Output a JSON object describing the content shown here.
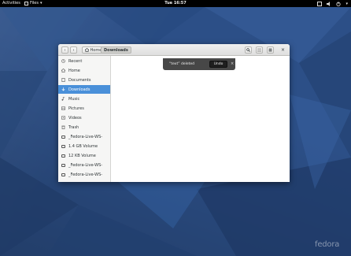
{
  "topbar": {
    "activities": "Activities",
    "app_menu": "Files",
    "clock": "Tue 16:57"
  },
  "window": {
    "path": {
      "home": "Home",
      "current": "Downloads"
    }
  },
  "sidebar": {
    "items": [
      {
        "label": "Recent",
        "icon": "clock-icon"
      },
      {
        "label": "Home",
        "icon": "home-icon"
      },
      {
        "label": "Documents",
        "icon": "document-icon"
      },
      {
        "label": "Downloads",
        "icon": "download-icon",
        "selected": true
      },
      {
        "label": "Music",
        "icon": "music-icon"
      },
      {
        "label": "Pictures",
        "icon": "picture-icon"
      },
      {
        "label": "Videos",
        "icon": "video-icon"
      },
      {
        "label": "Trash",
        "icon": "trash-icon"
      },
      {
        "label": "_Fedora-Live-WS-",
        "icon": "drive-icon"
      },
      {
        "label": "1.4 GB Volume",
        "icon": "drive-icon"
      },
      {
        "label": "12 KB Volume",
        "icon": "drive-icon"
      },
      {
        "label": "_Fedora-Live-WS-",
        "icon": "drive-icon"
      },
      {
        "label": "_Fedora-Live-WS-",
        "icon": "drive-icon"
      }
    ]
  },
  "notification": {
    "message": "“text” deleted",
    "undo_label": "Undo",
    "close_symbol": "×"
  },
  "branding": {
    "logo_text": "fedora"
  },
  "colors": {
    "desktop": "#2c4f87",
    "selection": "#4a90d9",
    "topbar": "#000000"
  }
}
